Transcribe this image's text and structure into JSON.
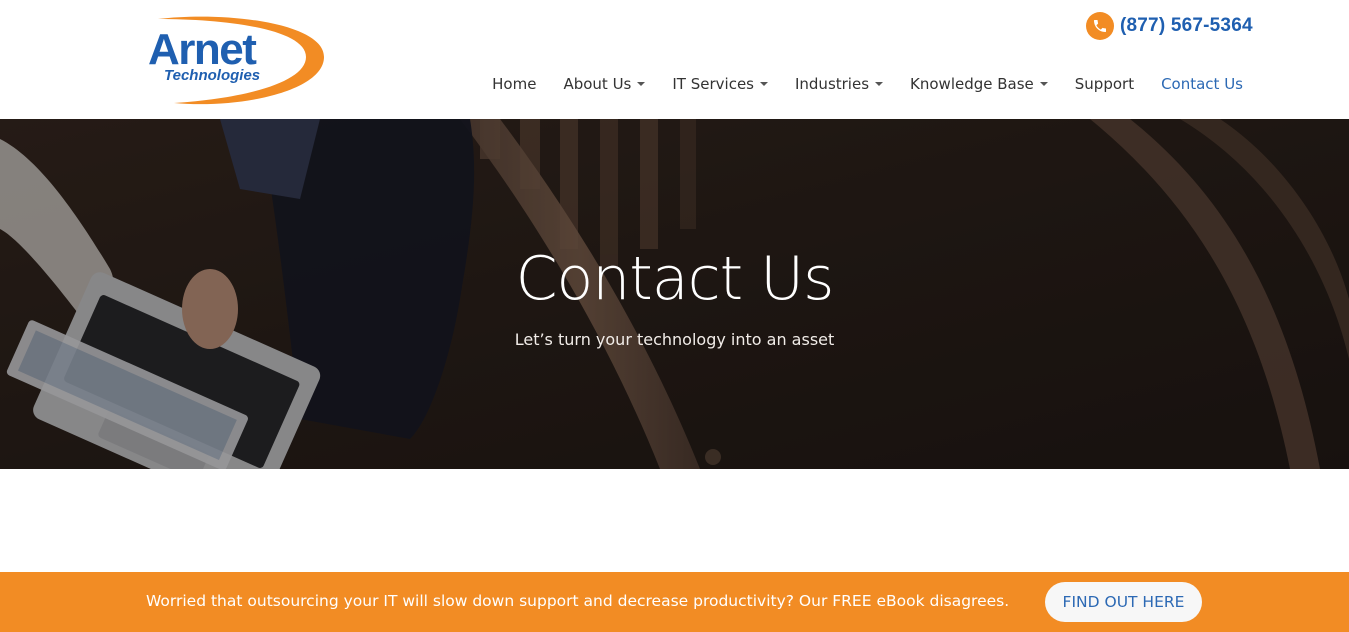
{
  "header": {
    "logo": {
      "line1": "Arnet",
      "line2": "Technologies",
      "icon": "arnet-swoosh-logo"
    },
    "phone": {
      "icon": "phone-icon",
      "number": "(877) 567-5364"
    },
    "nav": [
      {
        "label": "Home",
        "has_dropdown": false
      },
      {
        "label": "About Us",
        "has_dropdown": true
      },
      {
        "label": "IT Services",
        "has_dropdown": true
      },
      {
        "label": "Industries",
        "has_dropdown": true
      },
      {
        "label": "Knowledge Base",
        "has_dropdown": true
      },
      {
        "label": "Support",
        "has_dropdown": false
      },
      {
        "label": "Contact Us",
        "has_dropdown": false,
        "active": true
      }
    ]
  },
  "hero": {
    "title": "Contact Us",
    "subtitle": "Let’s turn your technology into an asset"
  },
  "banner": {
    "text": "Worried that outsourcing your IT will slow down support and decrease productivity? Our FREE eBook disagrees.",
    "button_label": "FIND OUT HERE"
  },
  "colors": {
    "accent_orange": "#f28c24",
    "brand_blue": "#1f5fb0",
    "link_blue": "#2c69b4"
  }
}
